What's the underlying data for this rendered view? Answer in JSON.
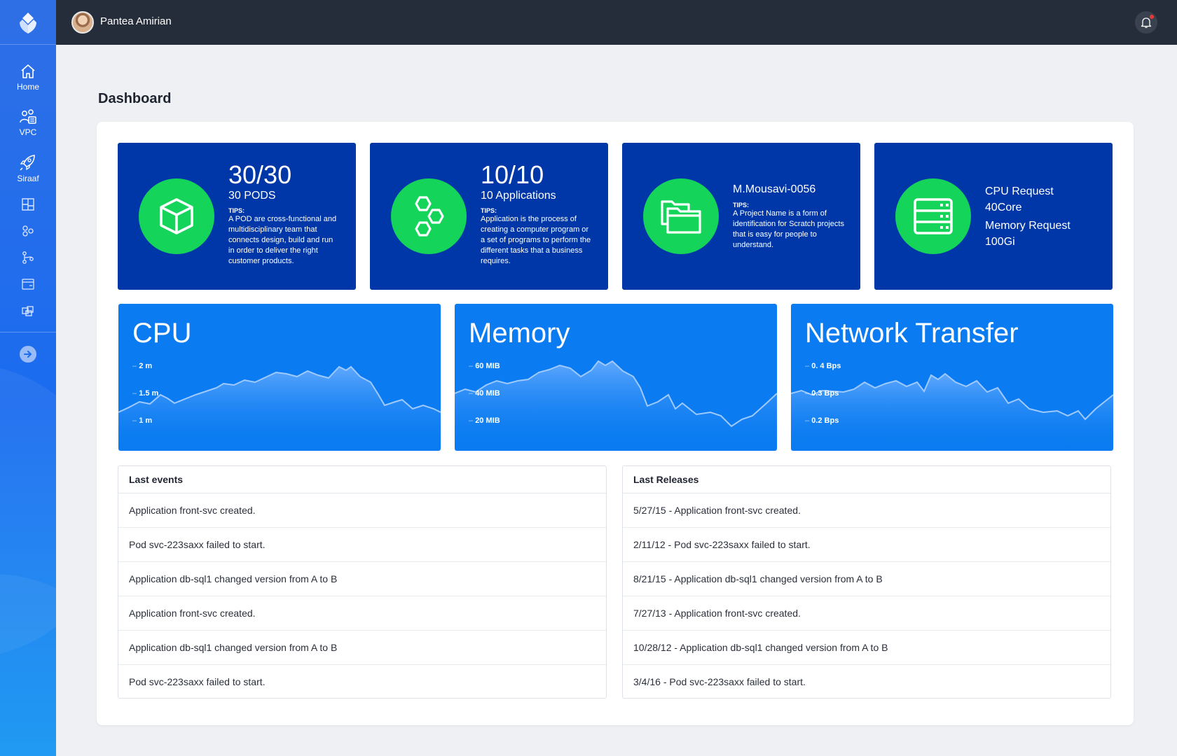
{
  "topbar": {
    "username": "Pantea Amirian"
  },
  "sidebar": {
    "items": [
      {
        "label": "Home",
        "icon": "home-icon"
      },
      {
        "label": "VPC",
        "icon": "users-icon"
      },
      {
        "label": "Siraaf",
        "icon": "rocket-icon"
      },
      {
        "label": "",
        "icon": "grid-icon"
      },
      {
        "label": "",
        "icon": "nodes-icon"
      },
      {
        "label": "",
        "icon": "git-icon"
      },
      {
        "label": "",
        "icon": "window-icon"
      },
      {
        "label": "",
        "icon": "cubes-icon"
      }
    ]
  },
  "page": {
    "title": "Dashboard"
  },
  "cards": {
    "pods": {
      "big": "30/30",
      "sub": "30 PODS",
      "tips_heading": "TIPS:",
      "tips": "A POD are cross-functional and multidisciplinary team that connects design, build and run in order to deliver the right customer products."
    },
    "apps": {
      "big": "10/10",
      "sub": "10 Applications",
      "tips_heading": "TIPS:",
      "tips": "Application is the process of creating a computer program or a set of programs to perform the different tasks that a business requires."
    },
    "project": {
      "name": "M.Mousavi-0056",
      "tips_heading": "TIPS:",
      "tips": "A Project Name is a form of identification for Scratch projects that is easy for people to understand."
    },
    "resources": {
      "cpu_label": "CPU Request",
      "cpu_value": "40Core",
      "mem_label": "Memory Request",
      "mem_value": "100Gi"
    }
  },
  "colors": {
    "card_dark": "#0037a8",
    "card_accent": "#14d45a",
    "metric_bg": "#0a7bf1",
    "topbar": "#262d3a"
  },
  "metrics": {
    "cpu": {
      "title": "CPU",
      "ticks": [
        "2 m",
        "1.5 m",
        "1 m"
      ]
    },
    "memory": {
      "title": "Memory",
      "ticks": [
        "60 MIB",
        "40 MIB",
        "20 MIB"
      ]
    },
    "network": {
      "title": "Network Transfer",
      "ticks": [
        "0. 4 Bps",
        "0.3 Bps",
        "0.2 Bps"
      ]
    }
  },
  "events": {
    "title": "Last events",
    "rows": [
      "Application front-svc created.",
      "Pod svc-223saxx failed to start.",
      "Application db-sql1 changed version from A to B",
      "Application front-svc created.",
      "Application db-sql1 changed version from A to B",
      "Pod svc-223saxx failed to start."
    ]
  },
  "releases": {
    "title": "Last Releases",
    "rows": [
      "5/27/15 - Application front-svc created.",
      "2/11/12 - Pod svc-223saxx failed to start.",
      "8/21/15 - Application db-sql1 changed version from A to B",
      "7/27/13 - Application front-svc created.",
      "10/28/12 - Application db-sql1 changed version from A to B",
      "3/4/16 - Pod svc-223saxx failed to start."
    ]
  }
}
